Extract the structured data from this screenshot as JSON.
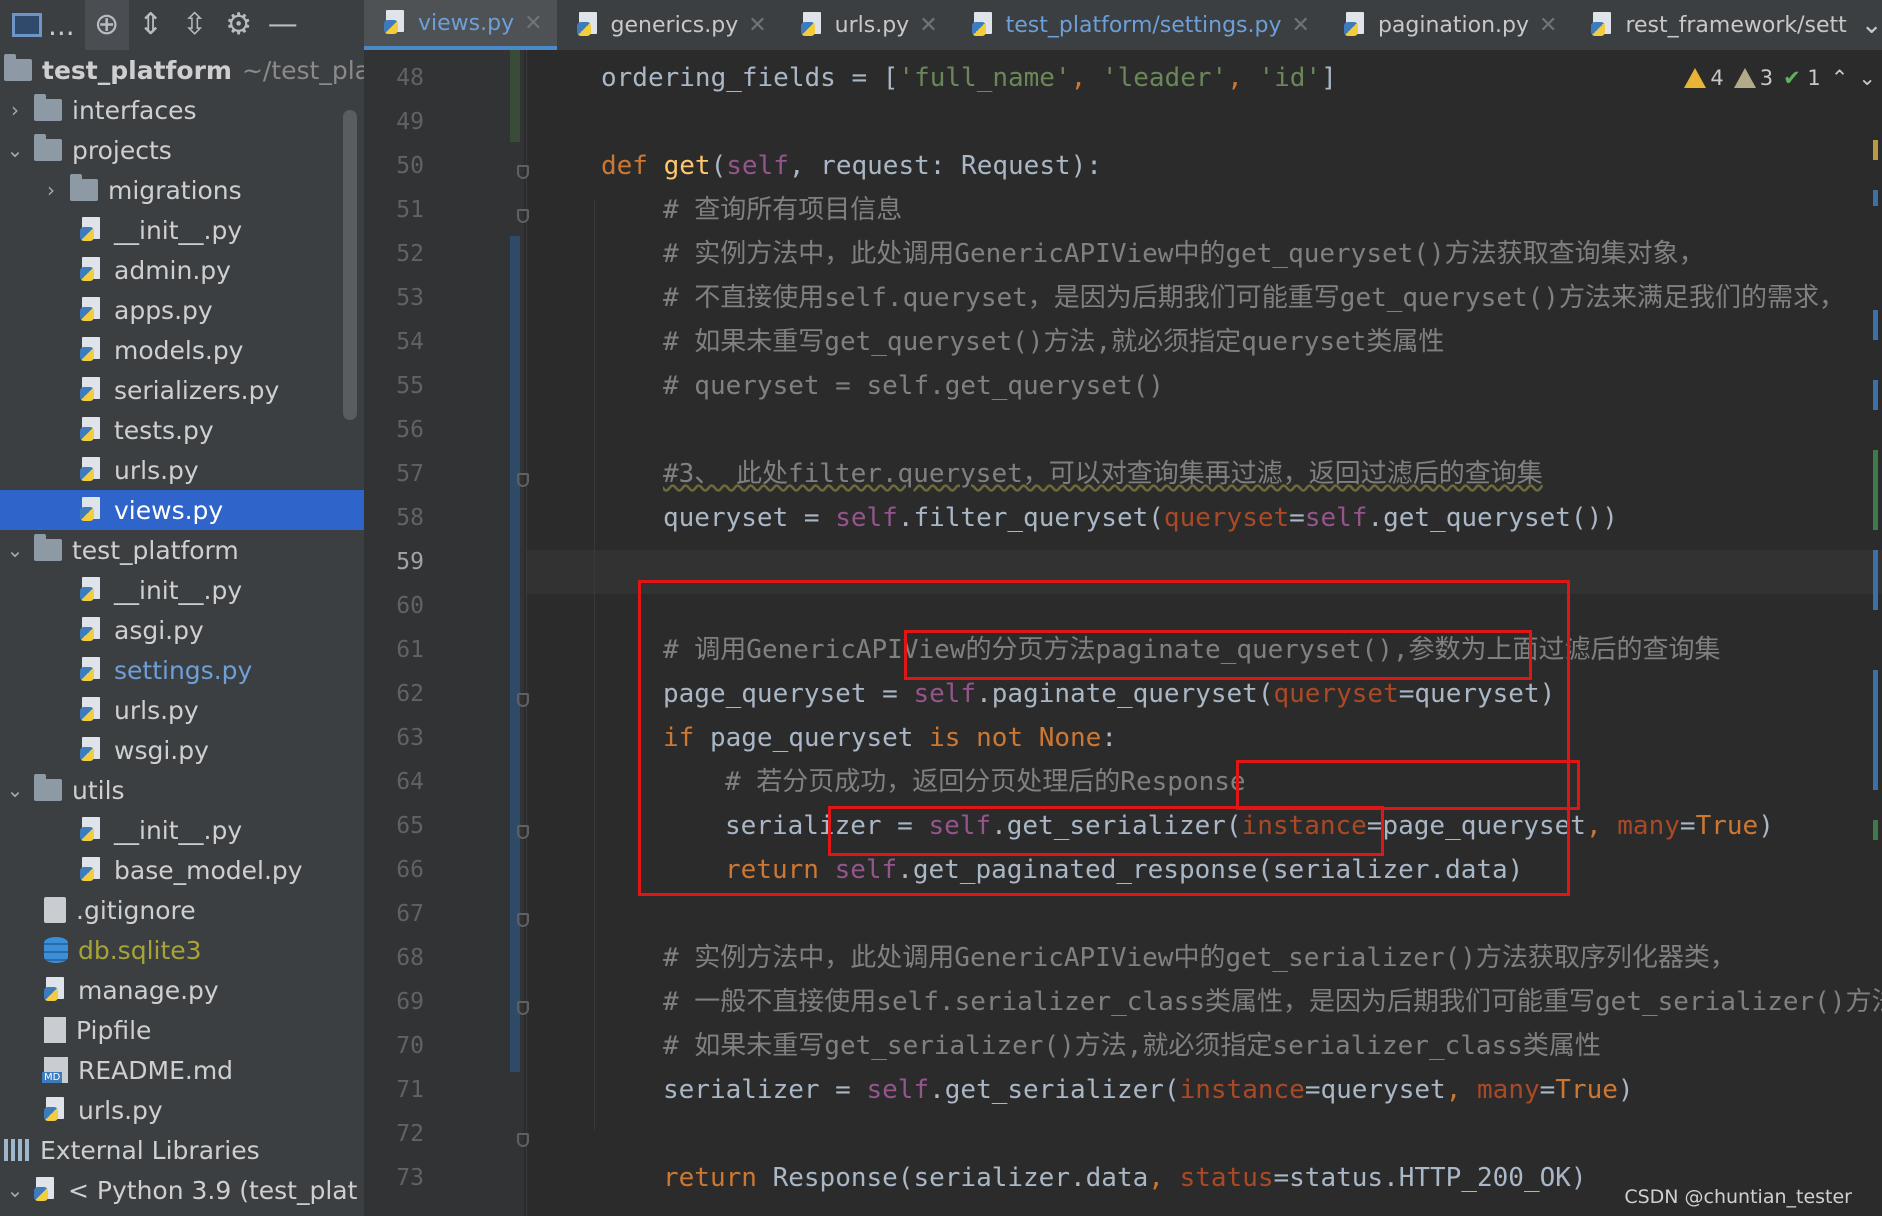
{
  "toolbar": {
    "dots": "...",
    "icons": [
      "project-icon",
      "crosshair-icon",
      "expand-all-icon",
      "collapse-all-icon",
      "gear-icon",
      "minimize-icon"
    ]
  },
  "tabs": [
    {
      "label": "views.py",
      "active": true
    },
    {
      "label": "generics.py"
    },
    {
      "label": "urls.py"
    },
    {
      "label": "test_platform/settings.py",
      "modified": true
    },
    {
      "label": "pagination.py"
    },
    {
      "label": "rest_framework/sett"
    }
  ],
  "tree": {
    "root_name": "test_platform",
    "root_path": "~/test_plat",
    "items": [
      {
        "label": "interfaces"
      },
      {
        "label": "projects"
      },
      {
        "label": "migrations"
      },
      {
        "label": "__init__.py"
      },
      {
        "label": "admin.py"
      },
      {
        "label": "apps.py"
      },
      {
        "label": "models.py"
      },
      {
        "label": "serializers.py"
      },
      {
        "label": "tests.py"
      },
      {
        "label": "urls.py"
      },
      {
        "label": "views.py"
      },
      {
        "label": "test_platform"
      },
      {
        "label": "__init__.py"
      },
      {
        "label": "asgi.py"
      },
      {
        "label": "settings.py"
      },
      {
        "label": "urls.py"
      },
      {
        "label": "wsgi.py"
      },
      {
        "label": "utils"
      },
      {
        "label": "__init__.py"
      },
      {
        "label": "base_model.py"
      },
      {
        "label": ".gitignore"
      },
      {
        "label": "db.sqlite3"
      },
      {
        "label": "manage.py"
      },
      {
        "label": "Pipfile"
      },
      {
        "label": "README.md"
      },
      {
        "label": "urls.py"
      },
      {
        "label": "External Libraries"
      },
      {
        "label": "< Python 3.9 (test_plat"
      }
    ]
  },
  "editor": {
    "line_numbers": [
      "48",
      "49",
      "50",
      "51",
      "52",
      "53",
      "54",
      "55",
      "56",
      "57",
      "58",
      "59",
      "60",
      "61",
      "62",
      "63",
      "64",
      "65",
      "66",
      "67",
      "68",
      "69",
      "70",
      "71",
      "72",
      "73"
    ],
    "current_line": "59",
    "inspections": {
      "warnings": "4",
      "weak_warnings": "3",
      "ok": "1"
    },
    "code": {
      "l48": {
        "a": "ordering_fields = [",
        "b": "'full_name'",
        "c": ", ",
        "d": "'leader'",
        "e": ", ",
        "f": "'id'",
        "g": "]"
      },
      "l50": {
        "a": "def ",
        "b": "get",
        "c": "(",
        "d": "self",
        "e": ", request: Request):"
      },
      "l51": "# 查询所有项目信息",
      "l52": "# 实例方法中，此处调用GenericAPIView中的get_queryset()方法获取查询集对象，",
      "l53": "# 不直接使用self.queryset，是因为后期我们可能重写get_queryset()方法来满足我们的需求，",
      "l54": "# 如果未重写get_queryset()方法,就必须指定queryset类属性",
      "l55": "# queryset = self.get_queryset()",
      "l57": "#3、 此处filter.queryset，可以对查询集再过滤，返回过滤后的查询集",
      "l58": {
        "a": "queryset = ",
        "b": "self",
        "c": ".filter_queryset(",
        "d": "queryset",
        "e": "=",
        "f": "self",
        "g": ".get_queryset())"
      },
      "l60": "# 调用GenericAPIView的分页方法paginate_queryset(),参数为上面过滤后的查询集",
      "l61": {
        "a": "page_queryset = ",
        "b": "self",
        "c": ".paginate_queryset(",
        "d": "queryset",
        "e": "=queryset)"
      },
      "l62": {
        "a": "if ",
        "b": "page_queryset ",
        "c": "is not None",
        "d": ":"
      },
      "l63": "# 若分页成功，返回分页处理后的Response",
      "l64": {
        "a": "serializer = ",
        "b": "self",
        "c": ".get_serializer(",
        "d": "instance",
        "e": "=page_queryset",
        "f": ", ",
        "g": "many",
        "h": "=",
        "i": "True",
        "j": ")"
      },
      "l65": {
        "a": "return ",
        "b": "self",
        "c": ".get_paginated_response(serializer.data)"
      },
      "l67": "# 实例方法中，此处调用GenericAPIView中的get_serializer()方法获取序列化器类，",
      "l68": "# 一般不直接使用self.serializer_class类属性，是因为后期我们可能重写get_serializer()方法",
      "l69": "# 如果未重写get_serializer()方法,就必须指定serializer_class类属性",
      "l70": {
        "a": "serializer = ",
        "b": "self",
        "c": ".get_serializer(",
        "d": "instance",
        "e": "=queryset",
        "f": ", ",
        "g": "many",
        "h": "=",
        "i": "True",
        "j": ")"
      },
      "l72": {
        "a": "return ",
        "b": "Response(serializer.data",
        "c": ", ",
        "d": "status",
        "e": "=status.HTTP_200_OK)"
      }
    }
  },
  "watermark": "CSDN @chuntian_tester",
  "colors": {
    "accent": "#2f65ca",
    "highlight_box": "#e01616",
    "keyword": "#cc7832",
    "self": "#94558d",
    "string": "#6a8759"
  }
}
